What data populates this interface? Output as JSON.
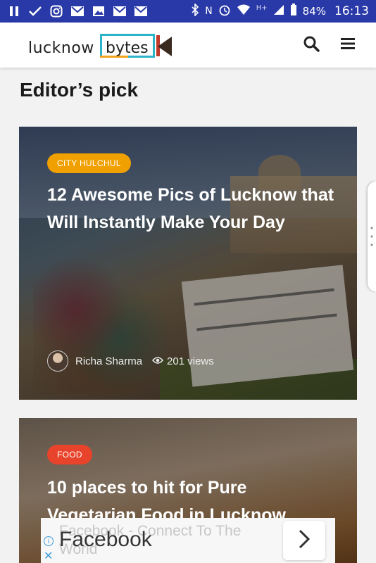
{
  "status_bar": {
    "battery": "84%",
    "time": "16:13",
    "network": "H+"
  },
  "header": {
    "logo_word1": "lucknow",
    "logo_word2": "bytes"
  },
  "section": {
    "title": "Editor’s pick"
  },
  "cards": [
    {
      "category": "CITY HULCHUL",
      "category_color": "#f0a000",
      "title": "12 Awesome Pics of Lucknow that Will Instantly Make Your Day",
      "author": "Richa Sharma",
      "views": "201 views"
    },
    {
      "category": "FOOD",
      "category_color": "#e8432b",
      "title": "10 places to hit for Pure Vegetarian Food in Lucknow"
    }
  ],
  "ad": {
    "headline": "Facebook - Connect To The World",
    "brand": "Facebook"
  }
}
